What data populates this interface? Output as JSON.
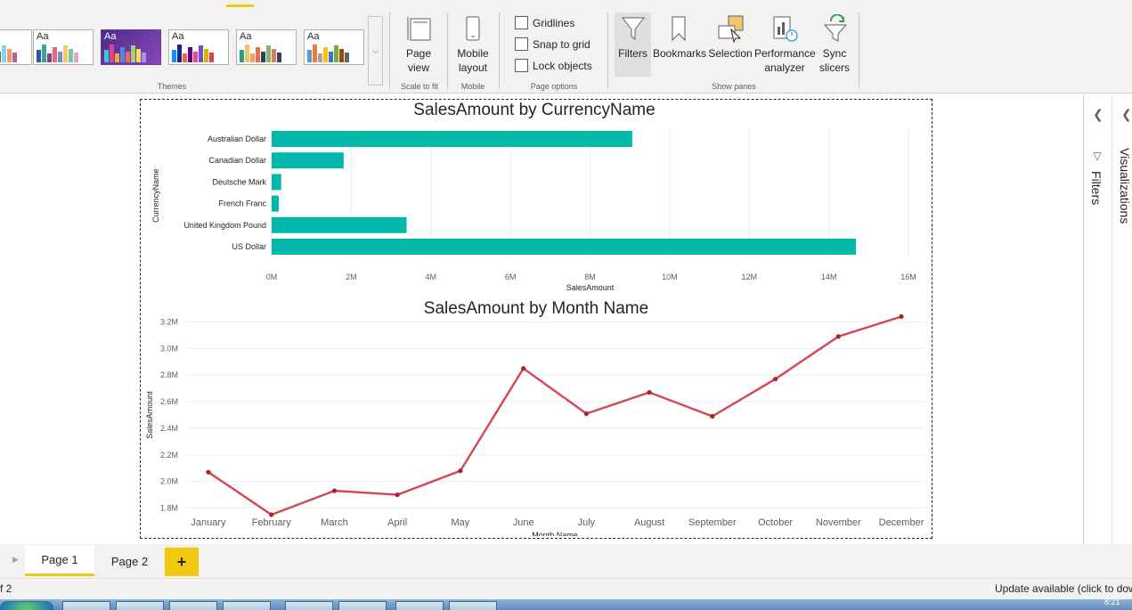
{
  "ribbon": {
    "themes": {
      "label": "Themes",
      "swatches": [
        {
          "name": "theme-1",
          "text": "Aa",
          "colors": [
            "#01b8aa",
            "#374649",
            "#fd625e",
            "#f2c80f",
            "#5f6b6d",
            "#8ad4eb",
            "#fe9666",
            "#a66999"
          ]
        },
        {
          "name": "theme-2",
          "text": "Aa",
          "colors": [
            "#3257a8",
            "#37a794",
            "#8b3d88",
            "#dd6b7f",
            "#6b91c9",
            "#f5c869",
            "#77c4a8",
            "#dea6cf"
          ]
        },
        {
          "name": "theme-3",
          "text": "Aa",
          "colors": [
            "#40c3d8",
            "#d04a8c",
            "#f5a53b",
            "#4a8ce0",
            "#e86a6a",
            "#9fd27b",
            "#f0e060",
            "#b48fe0"
          ]
        },
        {
          "name": "theme-4",
          "text": "Aa",
          "colors": [
            "#118dff",
            "#12239e",
            "#e66c37",
            "#6b007b",
            "#e044a7",
            "#744ec2",
            "#d9b300",
            "#d64550"
          ]
        },
        {
          "name": "theme-5",
          "text": "Aa",
          "colors": [
            "#2a9d8f",
            "#e9c46a",
            "#f4a261",
            "#e76f51",
            "#264653",
            "#8ab17d",
            "#e07a5f",
            "#3d405b"
          ]
        },
        {
          "name": "theme-6",
          "text": "Aa",
          "colors": [
            "#5b9bd5",
            "#ed7d31",
            "#a5a5a5",
            "#ffc000",
            "#4472c4",
            "#70ad47",
            "#9e480e",
            "#636363"
          ]
        }
      ]
    },
    "scale_to_fit": {
      "page_view_label": "Page\nview",
      "group_label": "Scale to fit"
    },
    "mobile": {
      "mobile_layout_label": "Mobile\nlayout",
      "group_label": "Mobile"
    },
    "page_options": {
      "gridlines": "Gridlines",
      "snap_to_grid": "Snap to grid",
      "lock_objects": "Lock objects",
      "group_label": "Page options"
    },
    "show_panes": {
      "filters": "Filters",
      "bookmarks": "Bookmarks",
      "selection": "Selection",
      "performance": "Performance\nanalyzer",
      "sync": "Sync\nslicers",
      "group_label": "Show panes"
    }
  },
  "right_panes": {
    "filters_label": "Filters",
    "visualizations_label": "Visualizations"
  },
  "page_tabs": {
    "tabs": [
      "Page 1",
      "Page 2"
    ],
    "active_index": 0,
    "add_label": "+"
  },
  "status": {
    "page_count": "f 2",
    "update_notice": "Update available (click to dow"
  },
  "clock": "8:21",
  "chart_data": [
    {
      "type": "bar",
      "orientation": "horizontal",
      "title": "SalesAmount by CurrencyName",
      "xlabel": "SalesAmount",
      "ylabel": "CurrencyName",
      "categories": [
        "Australian Dollar",
        "Canadian Dollar",
        "Deutsche Mark",
        "French Franc",
        "United Kingdom Pound",
        "US Dollar"
      ],
      "values": [
        9.06,
        1.81,
        0.24,
        0.18,
        3.39,
        14.68
      ],
      "value_unit": "M",
      "xlim": [
        0,
        16
      ],
      "xticks": [
        "0M",
        "2M",
        "4M",
        "6M",
        "8M",
        "10M",
        "12M",
        "14M",
        "16M"
      ],
      "grid": true,
      "color": "#01b8aa"
    },
    {
      "type": "line",
      "title": "SalesAmount by Month Name",
      "xlabel": "Month Name",
      "ylabel": "SalesAmount",
      "x": [
        "January",
        "February",
        "March",
        "April",
        "May",
        "June",
        "July",
        "August",
        "September",
        "October",
        "November",
        "December"
      ],
      "values": [
        2.07,
        1.75,
        1.93,
        1.9,
        2.08,
        2.85,
        2.51,
        2.67,
        2.49,
        2.77,
        3.09,
        3.24
      ],
      "value_unit": "M",
      "ylim": [
        1.75,
        3.25
      ],
      "yticks": [
        "1.8M",
        "2.0M",
        "2.2M",
        "2.4M",
        "2.6M",
        "2.8M",
        "3.0M",
        "3.2M"
      ],
      "grid": true,
      "color": "#d64550"
    }
  ]
}
